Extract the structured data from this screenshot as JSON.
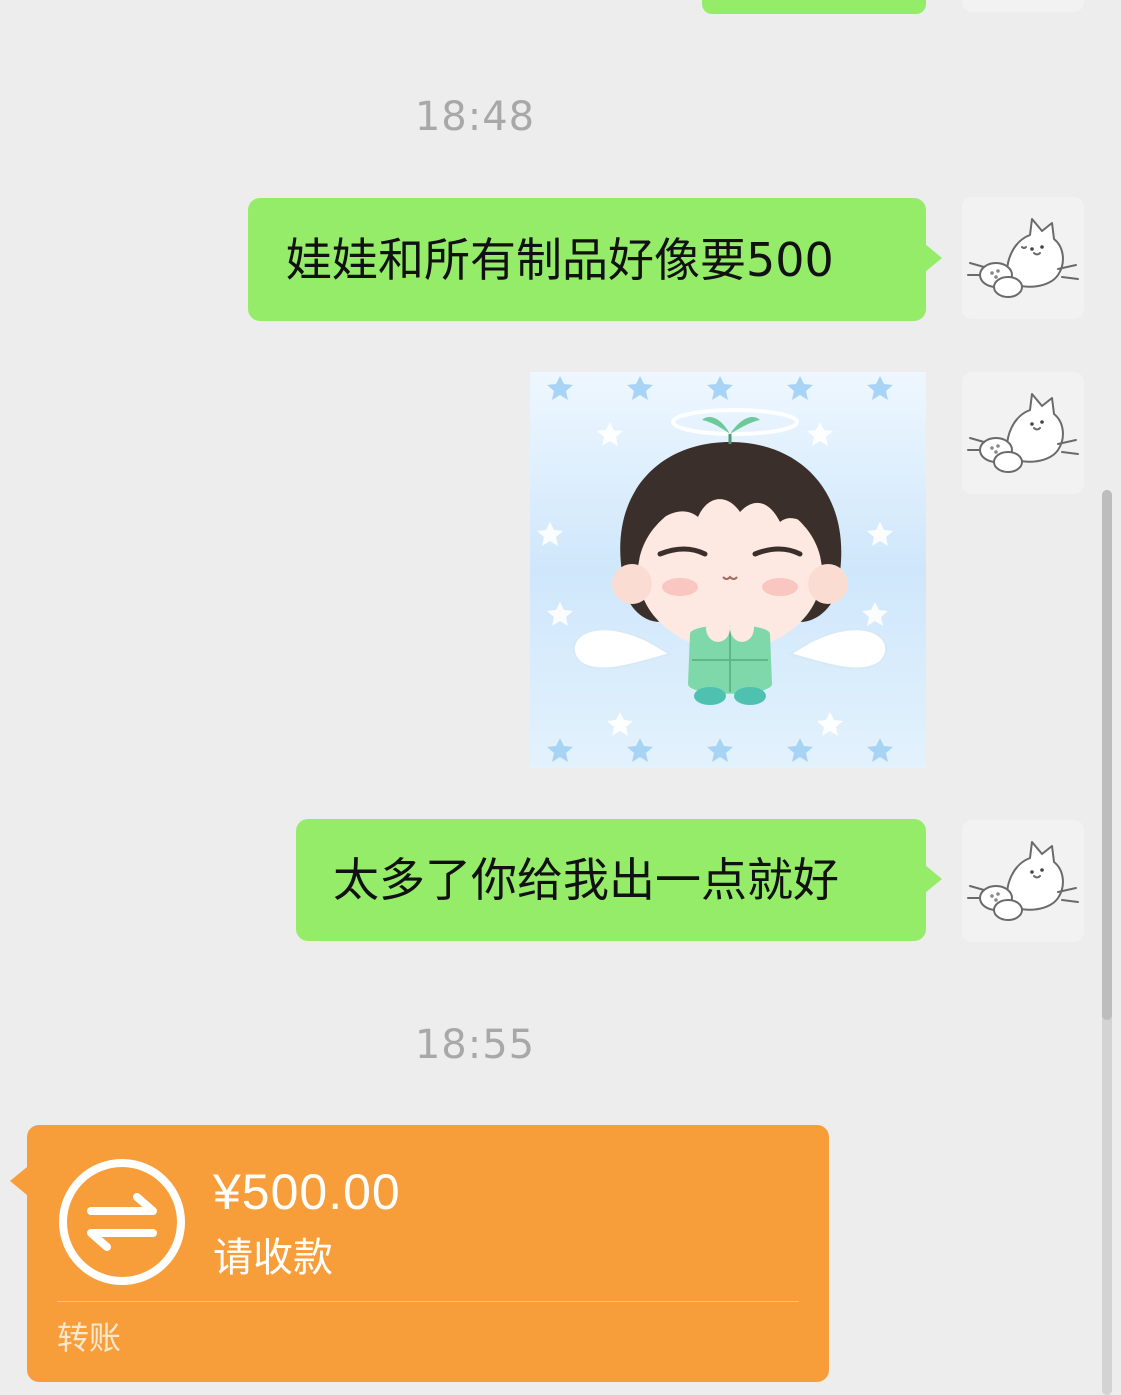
{
  "chat": {
    "timestamps": [
      "18:48",
      "18:55"
    ],
    "messages": {
      "msg1": "娃娃和所有制品好像要500",
      "msg2": "太多了你给我出一点就好"
    },
    "sticker": {
      "icon": "angel-chibi-doll-sticker"
    },
    "avatar": {
      "icon": "sketch-bunny-avatar"
    },
    "transfer": {
      "amount": "¥500.00",
      "note": "请收款",
      "footer": "转账",
      "icon": "transfer-arrows-icon"
    }
  },
  "colors": {
    "background": "#ededed",
    "outgoing_bubble": "#95ec69",
    "transfer_card": "#f79e3a",
    "timestamp_text": "#a8a8a8"
  }
}
